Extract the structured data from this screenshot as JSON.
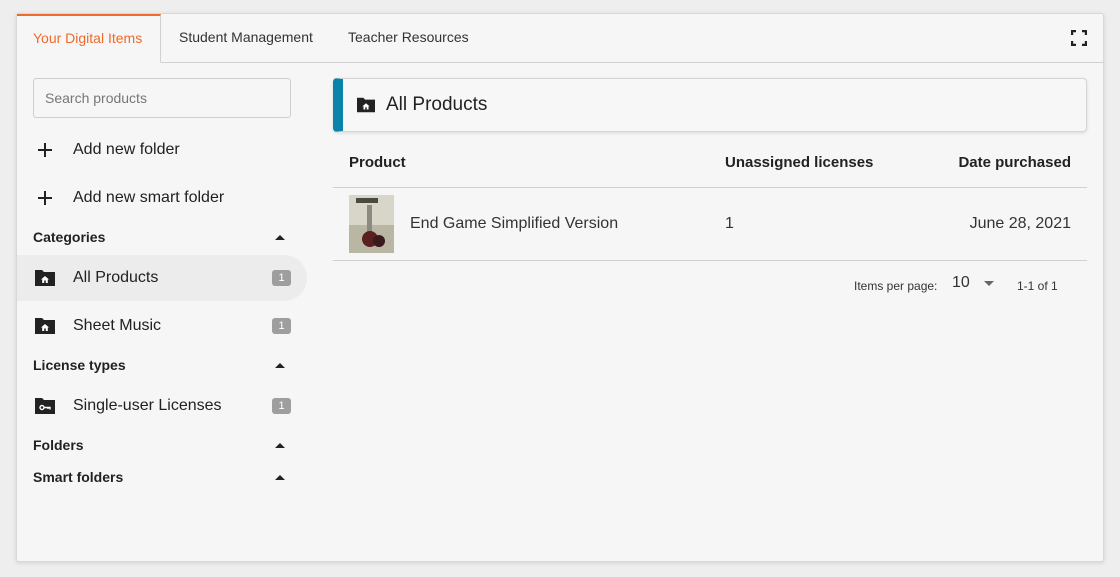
{
  "tabs": [
    {
      "label": "Your Digital Items",
      "active": true
    },
    {
      "label": "Student Management",
      "active": false
    },
    {
      "label": "Teacher Resources",
      "active": false
    }
  ],
  "fullscreen_icon": "fullscreen-icon",
  "sidebar": {
    "search": {
      "placeholder": "Search products",
      "value": ""
    },
    "actions": [
      {
        "label": "Add new folder",
        "icon": "plus-icon"
      },
      {
        "label": "Add new smart folder",
        "icon": "plus-icon"
      }
    ],
    "sections": {
      "categories": {
        "label": "Categories",
        "expanded": true,
        "items": [
          {
            "label": "All Products",
            "count": "1",
            "icon": "folder-home-icon",
            "selected": true
          },
          {
            "label": "Sheet Music",
            "count": "1",
            "icon": "folder-home-icon",
            "selected": false
          }
        ]
      },
      "license_types": {
        "label": "License types",
        "expanded": true,
        "items": [
          {
            "label": "Single-user Licenses",
            "count": "1",
            "icon": "folder-key-icon",
            "selected": false
          }
        ]
      },
      "folders": {
        "label": "Folders",
        "expanded": true
      },
      "smart_folders": {
        "label": "Smart folders",
        "expanded": true
      }
    }
  },
  "main": {
    "header": {
      "title": "All Products",
      "icon": "folder-home-icon",
      "accent": "#0a83aa"
    },
    "table": {
      "columns": [
        "Product",
        "Unassigned licenses",
        "Date purchased"
      ],
      "rows": [
        {
          "product": "End Game Simplified Version",
          "thumbnail": "product-thumbnail",
          "unassigned": "1",
          "date": "June 28, 2021"
        }
      ]
    },
    "paginator": {
      "items_per_page_label": "Items per page:",
      "items_per_page": "10",
      "range": "1-1 of 1"
    }
  },
  "colors": {
    "active_tab": "#ef6a2b",
    "header_accent": "#0a83aa",
    "badge": "#9e9e9e"
  }
}
